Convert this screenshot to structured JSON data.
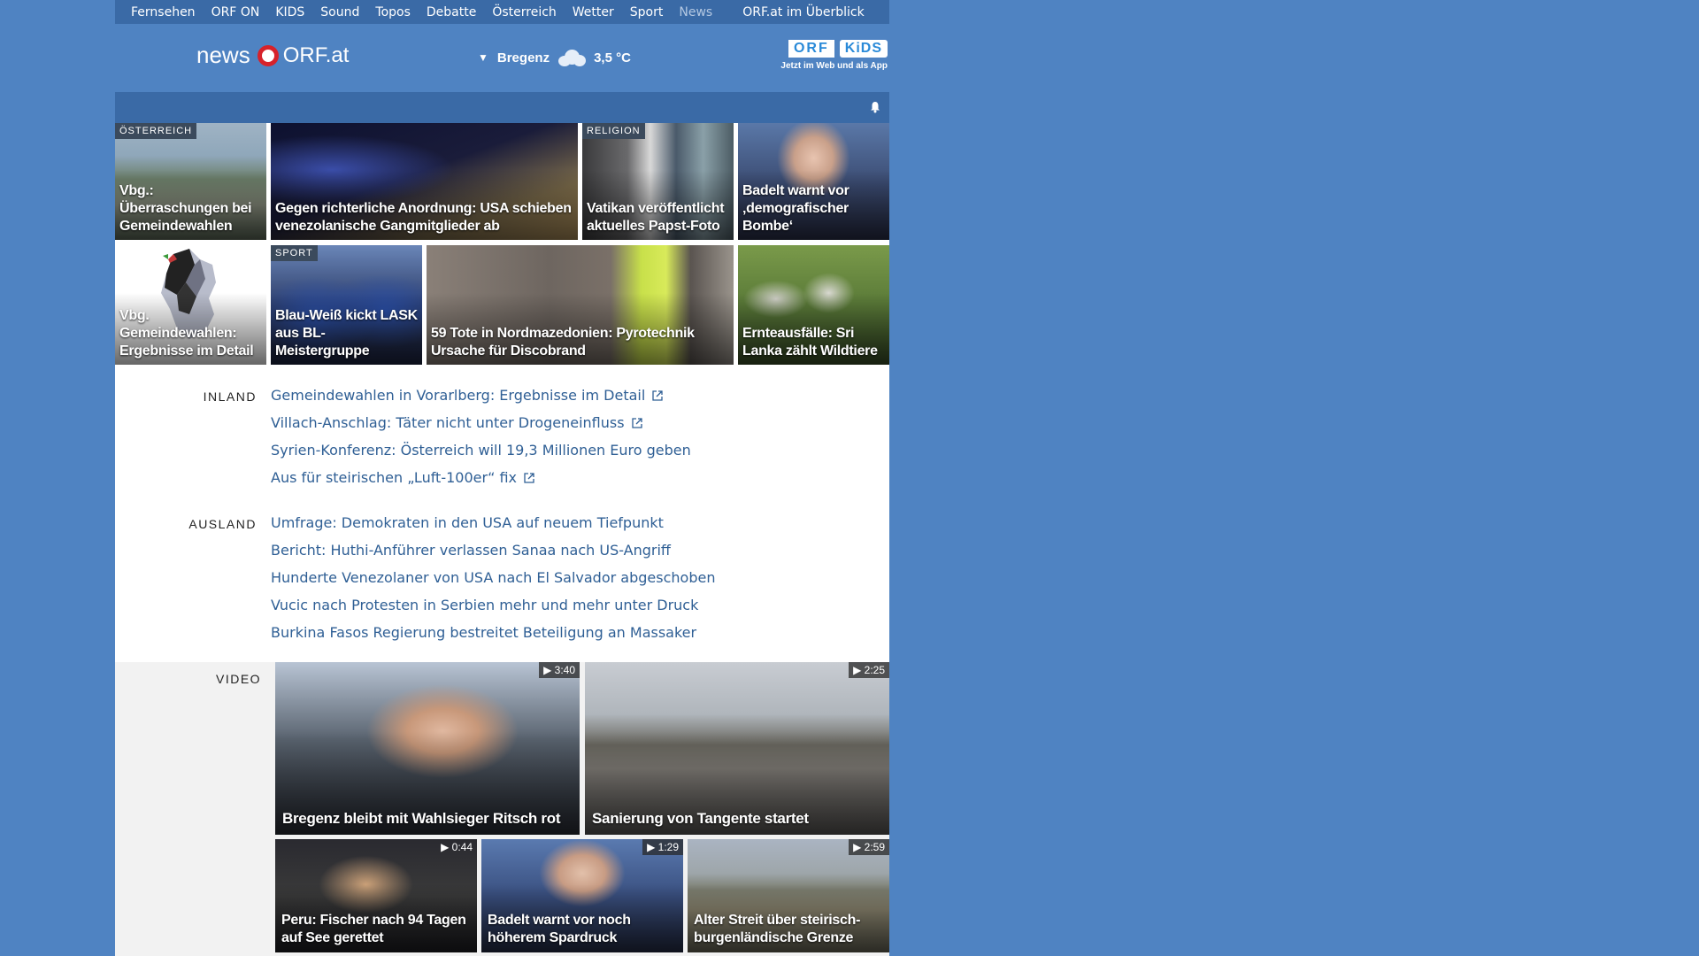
{
  "topnav": {
    "items": [
      "Fernsehen",
      "ORF ON",
      "KIDS",
      "Sound",
      "Topos",
      "Debatte",
      "Österreich",
      "Wetter",
      "Sport",
      "News"
    ],
    "overview": "ORF.at im Überblick"
  },
  "header": {
    "logo_news": "news",
    "logo_orfat": "ORF.at",
    "weather_city": "Bregenz",
    "weather_temp": "3,5 °C",
    "kids_badge_orf": "ORF",
    "kids_badge_kids": "KiDS",
    "kids_tagline": "Jetzt im Web und als App"
  },
  "tiles": [
    {
      "tag": "ÖSTERREICH",
      "title": "Vbg.: Überraschungen bei Gemeindewahlen"
    },
    {
      "tag": "",
      "title": "Gegen richterliche Anordnung: USA schieben venezolanische Gangmitglieder ab"
    },
    {
      "tag": "RELIGION",
      "title": "Vatikan veröffentlicht aktuelles Papst-Foto"
    },
    {
      "tag": "",
      "title": "Badelt warnt vor ‚demografischer Bombe‘"
    },
    {
      "tag": "",
      "title": "Vbg. Gemeindewahlen: Ergebnisse im Detail"
    },
    {
      "tag": "SPORT",
      "title": "Blau-Weiß kickt LASK aus BL-Meistergruppe"
    },
    {
      "tag": "",
      "title": "59 Tote in Nordmazedonien: Pyrotechnik Ursache für Discobrand"
    },
    {
      "tag": "",
      "title": "Ernteausfälle: Sri Lanka zählt Wildtiere"
    }
  ],
  "inland": {
    "label": "INLAND",
    "items": [
      "Gemeindewahlen in Vorarlberg: Ergebnisse im Detail",
      "Villach-Anschlag: Täter nicht unter Drogeneinfluss",
      "Syrien-Konferenz: Österreich will 19,3 Millionen Euro geben",
      "Aus für steirischen „Luft-100er“ fix"
    ]
  },
  "ausland": {
    "label": "AUSLAND",
    "items": [
      "Umfrage: Demokraten in den USA auf neuem Tiefpunkt",
      "Bericht: Huthi-Anführer verlassen Sanaa nach US-Angriff",
      "Hunderte Venezolaner von USA nach El Salvador abgeschoben",
      "Vucic nach Protesten in Serbien mehr und mehr unter Druck",
      "Burkina Fasos Regierung bestreitet Beteiligung an Massaker"
    ]
  },
  "video": {
    "label": "VIDEO",
    "items": [
      {
        "duration": "3:40",
        "title": "Bregenz bleibt mit Wahlsieger Ritsch rot"
      },
      {
        "duration": "2:25",
        "title": "Sanierung von Tangente startet"
      },
      {
        "duration": "0:44",
        "title": "Peru: Fischer nach 94 Tagen auf See gerettet"
      },
      {
        "duration": "1:29",
        "title": "Badelt warnt vor noch höherem Spardruck"
      },
      {
        "duration": "2:59",
        "title": "Alter Streit über steirisch-burgenländische Grenze"
      }
    ]
  }
}
